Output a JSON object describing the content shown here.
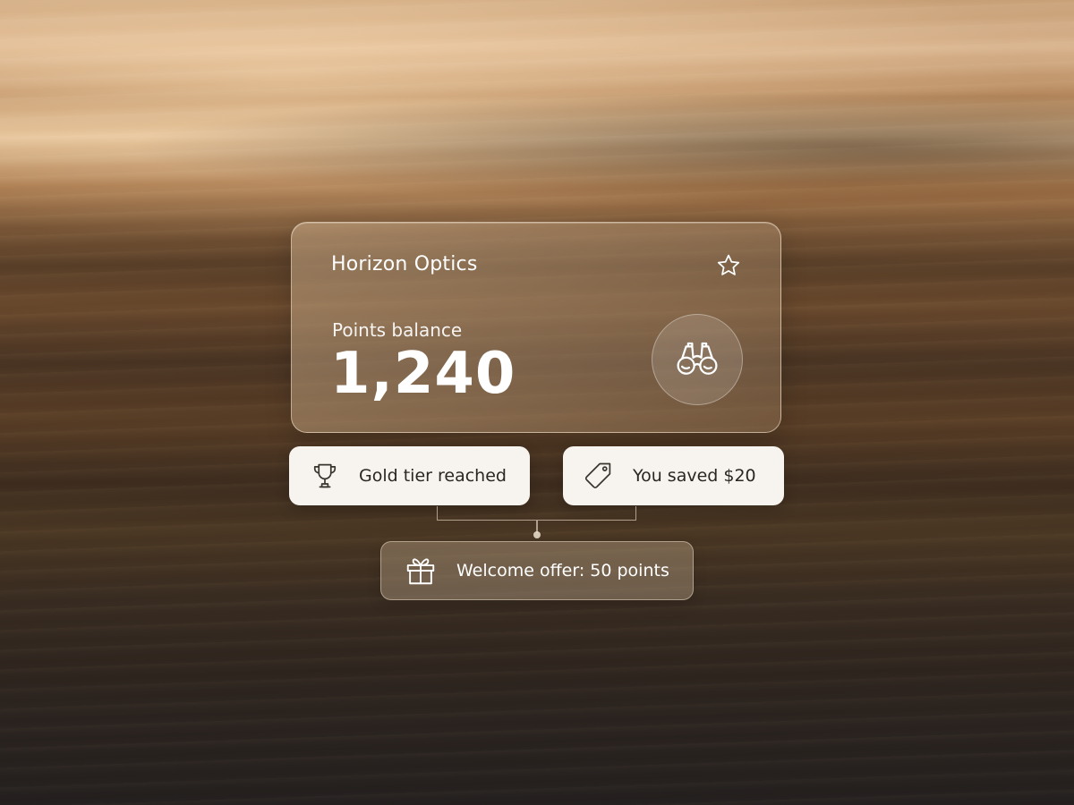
{
  "card": {
    "brand": "Horizon Optics",
    "balance_label": "Points balance",
    "balance_value": "1,240",
    "favorite_icon": "star-icon",
    "badge_icon": "binoculars-icon"
  },
  "rewards": {
    "gold": {
      "label": "Gold tier reached",
      "icon": "trophy-icon"
    },
    "saved": {
      "label": "You saved $20",
      "icon": "tag-icon"
    },
    "offer": {
      "label": "Welcome offer: 50 points",
      "icon": "gift-icon"
    }
  },
  "colors": {
    "pill_background": "#f7f4ef",
    "pill_text": "#2a2622",
    "card_text": "#ffffff"
  }
}
